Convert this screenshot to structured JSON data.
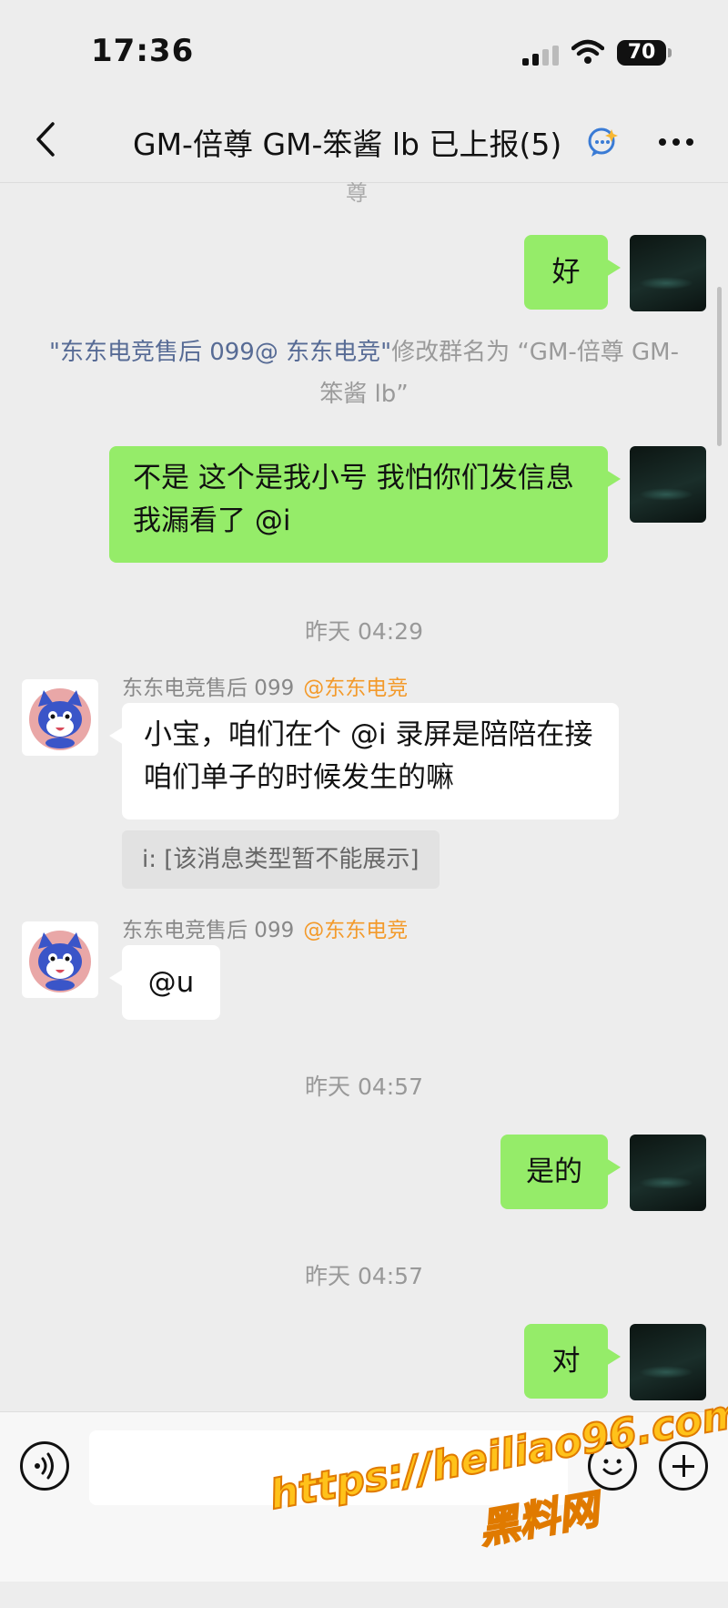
{
  "status_bar": {
    "time": "17:36",
    "battery": "70"
  },
  "nav": {
    "title": "GM-倍尊 GM-笨酱 lb 已上报(5)"
  },
  "chat": {
    "partial_line": "尊",
    "messages": [
      {
        "kind": "self",
        "text": "好"
      },
      {
        "kind": "system",
        "actor": "\"东东电竞售后 099@ 东东电竞\"",
        "action": "修改群名为 “GM-倍尊 GM-笨酱 lb”"
      },
      {
        "kind": "self",
        "text": "不是 这个是我小号 我怕你们发信息我漏看了 @i"
      },
      {
        "kind": "time",
        "text": "昨天 04:29"
      },
      {
        "kind": "other",
        "sender": "东东电竞售后 099",
        "sender_tag": "@东东电竞",
        "text": "小宝，咱们在个 @i 录屏是陪陪在接咱们单子的时候发生的嘛",
        "quote": "i: [该消息类型暂不能展示]"
      },
      {
        "kind": "other",
        "sender": "东东电竞售后 099",
        "sender_tag": "@东东电竞",
        "text": "@u"
      },
      {
        "kind": "time",
        "text": "昨天 04:57"
      },
      {
        "kind": "self",
        "text": "是的"
      },
      {
        "kind": "time",
        "text": "昨天 04:57"
      },
      {
        "kind": "self",
        "text": "对"
      }
    ]
  },
  "input": {
    "placeholder": ""
  },
  "watermark": {
    "url": "https://heiliao96.com",
    "name": "黑料网"
  }
}
